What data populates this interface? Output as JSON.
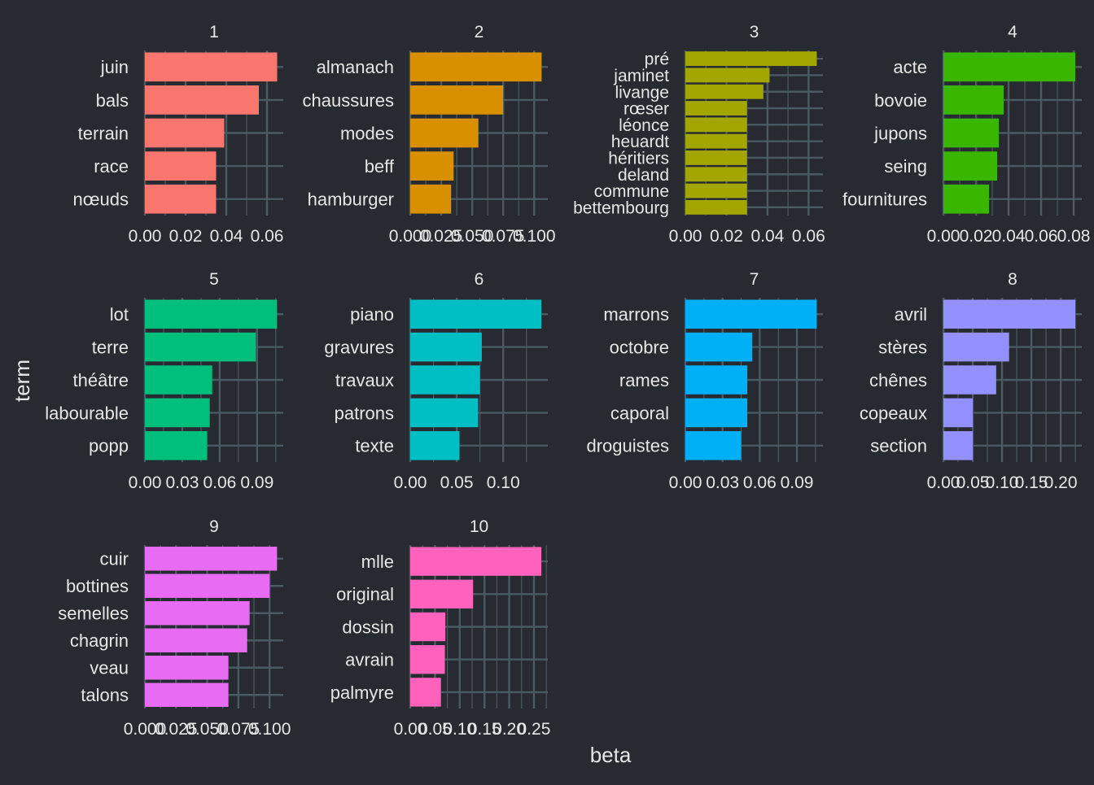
{
  "colors": {
    "background": "#272a30",
    "grid": "#4a5a63",
    "text": "#e6e6e6",
    "panel_fills": [
      "#f8766d",
      "#d89000",
      "#a3a500",
      "#39b600",
      "#00bf7d",
      "#00bfc4",
      "#00b0f6",
      "#9590ff",
      "#e76bf3",
      "#ff62bc"
    ]
  },
  "chart_data": {
    "type": "bar",
    "orientation": "horizontal",
    "layout": "facet-wrap 4 columns, free scales",
    "xlabel": "beta",
    "ylabel": "term",
    "grid": true,
    "legend": "none",
    "panels": [
      {
        "title": "1",
        "categories": [
          "juin",
          "bals",
          "terrain",
          "race",
          "nœuds"
        ],
        "values": [
          0.065,
          0.056,
          0.039,
          0.035,
          0.035
        ],
        "xlim": [
          0,
          0.068
        ],
        "ticks": [
          0,
          0.02,
          0.04,
          0.06
        ],
        "tick_labels": [
          "0.00",
          "0.02",
          "0.04",
          "0.06"
        ]
      },
      {
        "title": "2",
        "categories": [
          "almanach",
          "chaussures",
          "modes",
          "beff",
          "hamburger"
        ],
        "values": [
          0.106,
          0.075,
          0.055,
          0.035,
          0.033
        ],
        "xlim": [
          0,
          0.111
        ],
        "ticks": [
          0,
          0.025,
          0.05,
          0.075,
          0.1
        ],
        "tick_labels": [
          "0.000",
          "0.025",
          "0.050",
          "0.075",
          "0.100"
        ]
      },
      {
        "title": "3",
        "categories": [
          "pré",
          "jaminet",
          "livange",
          "rœser",
          "léonce",
          "heuardt",
          "héritiers",
          "deland",
          "commune",
          "bettembourg"
        ],
        "values": [
          0.064,
          0.041,
          0.038,
          0.03,
          0.03,
          0.03,
          0.03,
          0.03,
          0.03,
          0.03
        ],
        "xlim": [
          0,
          0.067
        ],
        "ticks": [
          0,
          0.02,
          0.04,
          0.06
        ],
        "tick_labels": [
          "0.00",
          "0.02",
          "0.04",
          "0.06"
        ]
      },
      {
        "title": "4",
        "categories": [
          "acte",
          "bovoie",
          "jupons",
          "seing",
          "fournitures"
        ],
        "values": [
          0.081,
          0.037,
          0.034,
          0.033,
          0.028
        ],
        "xlim": [
          0,
          0.085
        ],
        "ticks": [
          0,
          0.02,
          0.04,
          0.06,
          0.08
        ],
        "tick_labels": [
          "0.00",
          "0.02",
          "0.04",
          "0.06",
          "0.08"
        ]
      },
      {
        "title": "5",
        "categories": [
          "lot",
          "terre",
          "théâtre",
          "labourable",
          "popp"
        ],
        "values": [
          0.106,
          0.089,
          0.054,
          0.052,
          0.05
        ],
        "xlim": [
          0,
          0.111
        ],
        "ticks": [
          0,
          0.03,
          0.06,
          0.09
        ],
        "tick_labels": [
          "0.00",
          "0.03",
          "0.06",
          "0.09"
        ]
      },
      {
        "title": "6",
        "categories": [
          "piano",
          "gravures",
          "travaux",
          "patrons",
          "texte"
        ],
        "values": [
          0.141,
          0.077,
          0.075,
          0.073,
          0.053
        ],
        "xlim": [
          0,
          0.148
        ],
        "ticks": [
          0,
          0.05,
          0.1
        ],
        "tick_labels": [
          "0.00",
          "0.05",
          "0.10"
        ]
      },
      {
        "title": "7",
        "categories": [
          "marrons",
          "octobre",
          "rames",
          "caporal",
          "droguistes"
        ],
        "values": [
          0.106,
          0.054,
          0.05,
          0.05,
          0.045
        ],
        "xlim": [
          0,
          0.111
        ],
        "ticks": [
          0,
          0.03,
          0.06,
          0.09
        ],
        "tick_labels": [
          "0.00",
          "0.03",
          "0.06",
          "0.09"
        ]
      },
      {
        "title": "8",
        "categories": [
          "avril",
          "stères",
          "chênes",
          "copeaux",
          "section"
        ],
        "values": [
          0.225,
          0.112,
          0.09,
          0.05,
          0.05
        ],
        "xlim": [
          0,
          0.236
        ],
        "ticks": [
          0,
          0.05,
          0.1,
          0.15,
          0.2
        ],
        "tick_labels": [
          "0.00",
          "0.05",
          "0.10",
          "0.15",
          "0.20"
        ]
      },
      {
        "title": "9",
        "categories": [
          "cuir",
          "bottines",
          "semelles",
          "chagrin",
          "veau",
          "talons"
        ],
        "values": [
          0.106,
          0.1,
          0.084,
          0.082,
          0.067,
          0.067
        ],
        "xlim": [
          0,
          0.111
        ],
        "ticks": [
          0,
          0.025,
          0.05,
          0.075,
          0.1
        ],
        "tick_labels": [
          "0.000",
          "0.025",
          "0.050",
          "0.075",
          "0.100"
        ]
      },
      {
        "title": "10",
        "categories": [
          "mlle",
          "original",
          "dossin",
          "avrain",
          "palmyre"
        ],
        "values": [
          0.265,
          0.127,
          0.071,
          0.07,
          0.062
        ],
        "xlim": [
          0,
          0.278
        ],
        "ticks": [
          0,
          0.05,
          0.1,
          0.15,
          0.2,
          0.25
        ],
        "tick_labels": [
          "0.00",
          "0.05",
          "0.10",
          "0.15",
          "0.20",
          "0.25"
        ]
      }
    ]
  }
}
